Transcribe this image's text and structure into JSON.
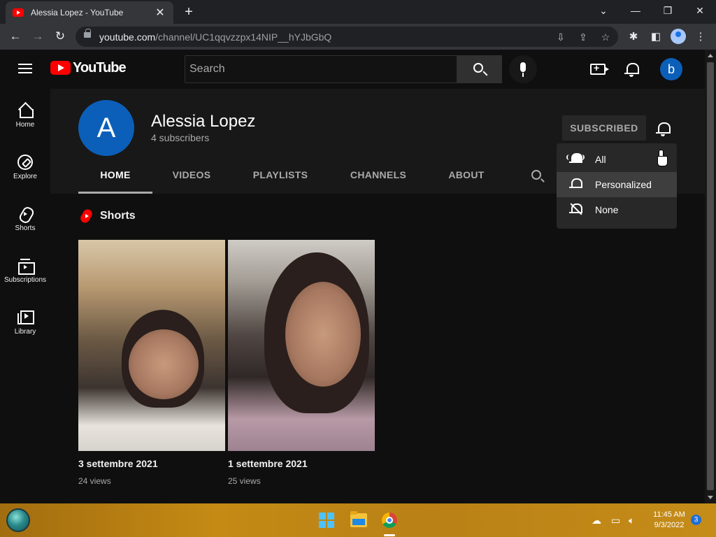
{
  "browser": {
    "tab_title": "Alessia Lopez - YouTube",
    "tab_close": "✕",
    "new_tab": "+",
    "url_host": "youtube.com",
    "url_path": "/channel/UC1qqvzzpx14NIP__hYJbGbQ",
    "window_controls": {
      "list": "⌄",
      "minimize": "—",
      "restore": "❐",
      "close": "✕"
    },
    "nav": {
      "back": "←",
      "forward": "→",
      "reload": "↻"
    }
  },
  "youtube": {
    "logo_text": "YouTube",
    "search_placeholder": "Search",
    "avatar_letter": "b",
    "guide": [
      {
        "label": "Home",
        "icon": "home-icon"
      },
      {
        "label": "Explore",
        "icon": "explore-icon"
      },
      {
        "label": "Shorts",
        "icon": "shorts-icon"
      },
      {
        "label": "Subscriptions",
        "icon": "subscriptions-icon"
      },
      {
        "label": "Library",
        "icon": "library-icon"
      }
    ]
  },
  "channel": {
    "avatar_letter": "A",
    "name": "Alessia Lopez",
    "subscribers": "4 subscribers",
    "subscribe_label": "SUBSCRIBED",
    "tabs": [
      "HOME",
      "VIDEOS",
      "PLAYLISTS",
      "CHANNELS",
      "ABOUT"
    ],
    "active_tab": "HOME"
  },
  "shorts": {
    "heading": "Shorts",
    "items": [
      {
        "title": "3 settembre 2021",
        "views": "24 views"
      },
      {
        "title": "1 settembre 2021",
        "views": "25 views"
      }
    ]
  },
  "notification_menu": {
    "items": [
      {
        "label": "All",
        "icon": "bell-ringing-icon"
      },
      {
        "label": "Personalized",
        "icon": "bell-icon",
        "highlighted": true
      },
      {
        "label": "None",
        "icon": "bell-off-icon"
      }
    ]
  },
  "taskbar": {
    "time": "11:45 AM",
    "date": "9/3/2022",
    "notification_count": "3"
  },
  "colors": {
    "yt_red": "#ff0000",
    "channel_avatar": "#0b5fb8",
    "page_bg": "#0f0f0f",
    "header_bg": "#181818"
  }
}
